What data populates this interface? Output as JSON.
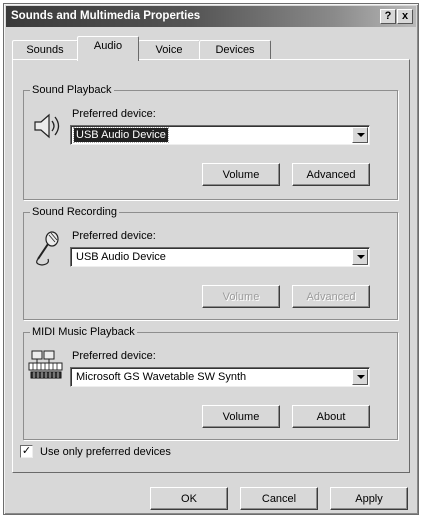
{
  "window": {
    "title": "Sounds and Multimedia Properties",
    "help_glyph": "?",
    "close_glyph": "x"
  },
  "tabs": [
    {
      "label": "Sounds",
      "active": false
    },
    {
      "label": "Audio",
      "active": true
    },
    {
      "label": "Voice",
      "active": false
    },
    {
      "label": "Devices",
      "active": false
    }
  ],
  "playback": {
    "group_label": "Sound Playback",
    "icon": "speaker-icon",
    "device_label": "Preferred device:",
    "device_value": "USB Audio Device",
    "volume_label": "Volume",
    "advanced_label": "Advanced"
  },
  "recording": {
    "group_label": "Sound Recording",
    "icon": "microphone-icon",
    "device_label": "Preferred device:",
    "device_value": "USB Audio Device",
    "volume_label": "Volume",
    "advanced_label": "Advanced"
  },
  "midi": {
    "group_label": "MIDI Music Playback",
    "icon": "midi-keyboard-icon",
    "device_label": "Preferred device:",
    "device_value": "Microsoft GS Wavetable SW Synth",
    "volume_label": "Volume",
    "about_label": "About"
  },
  "preferred_only": {
    "label": "Use only preferred devices",
    "checked": true,
    "check_glyph": "✓"
  },
  "footer": {
    "ok_label": "OK",
    "cancel_label": "Cancel",
    "apply_label": "Apply"
  }
}
